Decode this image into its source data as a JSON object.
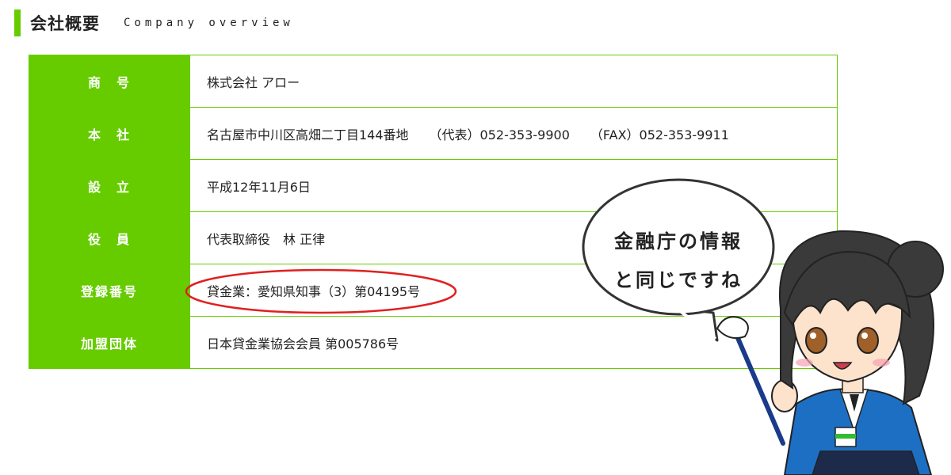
{
  "header": {
    "title": "会社概要",
    "subtitle": "Company overview"
  },
  "company_table": {
    "rows": [
      {
        "label": "商　号",
        "value": "株式会社 アロー"
      },
      {
        "label": "本　社",
        "address": "名古屋市中川区高畑二丁目144番地",
        "phone": "（代表）052-353-9900",
        "fax": "（FAX）052-353-9911"
      },
      {
        "label": "設　立",
        "value": "平成12年11月6日"
      },
      {
        "label": "役　員",
        "value": "代表取締役　林 正律"
      },
      {
        "label": "登録番号",
        "value": "貸金業：愛知県知事（3）第04195号"
      },
      {
        "label": "加盟団体",
        "value": "日本貸金業協会会員 第005786号"
      }
    ]
  },
  "speech_bubble": {
    "line1": "金融庁の情報",
    "line2": "と同じですね"
  },
  "colors": {
    "accent_green": "#66cc00",
    "highlight_red": "#e02020"
  }
}
